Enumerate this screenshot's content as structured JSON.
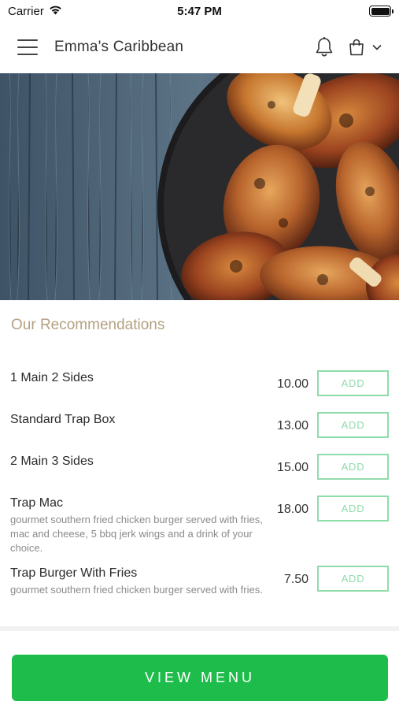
{
  "status_bar": {
    "carrier": "Carrier",
    "time": "5:47 PM",
    "wifi_icon": "wifi-icon",
    "battery_icon": "battery-icon"
  },
  "header": {
    "title": "Emma's Caribbean",
    "menu_icon": "hamburger-menu-icon",
    "notification_icon": "bell-icon",
    "cart_icon": "shopping-bag-icon",
    "dropdown_icon": "chevron-down-icon"
  },
  "hero": {
    "image": "jerk-chicken-drumsticks-on-wood"
  },
  "recommendations": {
    "title": "Our Recommendations",
    "items": [
      {
        "name": "1 Main 2 Sides",
        "description": "",
        "price": "10.00",
        "button": "ADD"
      },
      {
        "name": "Standard Trap Box",
        "description": "",
        "price": "13.00",
        "button": "ADD"
      },
      {
        "name": "2 Main 3 Sides",
        "description": "",
        "price": "15.00",
        "button": "ADD"
      },
      {
        "name": "Trap Mac",
        "description": "gourmet southern fried chicken burger served with fries, mac and cheese, 5 bbq jerk wings and a drink of your choice.",
        "price": "18.00",
        "button": "ADD"
      },
      {
        "name": "Trap Burger With Fries",
        "description": "gourmet southern fried chicken burger  served with fries.",
        "price": "7.50",
        "button": "ADD"
      }
    ]
  },
  "footer": {
    "view_menu": "VIEW MENU"
  },
  "colors": {
    "accent_green": "#1ebd4b",
    "add_outline": "#8fdcab",
    "section_title": "#b3a181"
  }
}
